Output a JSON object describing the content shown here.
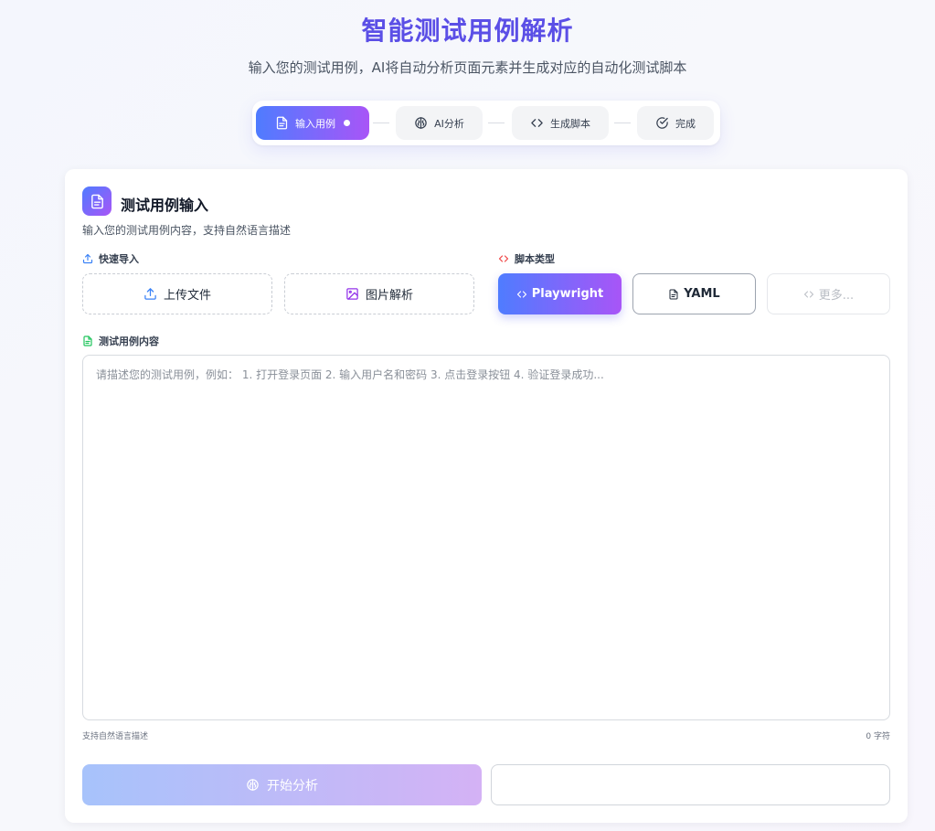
{
  "header": {
    "title": "智能测试用例解析",
    "subtitle": "输入您的测试用例，AI将自动分析页面元素并生成对应的自动化测试脚本"
  },
  "steps": [
    {
      "label": "输入用例",
      "icon": "document-icon",
      "active": true
    },
    {
      "label": "AI分析",
      "icon": "brain-icon",
      "active": false
    },
    {
      "label": "生成脚本",
      "icon": "code-icon",
      "active": false
    },
    {
      "label": "完成",
      "icon": "check-circle-icon",
      "active": false
    }
  ],
  "card": {
    "title": "测试用例输入",
    "description": "输入您的测试用例内容，支持自然语言描述",
    "icon": "document-icon"
  },
  "quick_import": {
    "label": "快速导入",
    "icon": "upload-icon",
    "upload_label": "上传文件",
    "image_label": "图片解析"
  },
  "script_type": {
    "label": "脚本类型",
    "icon": "code-icon",
    "options": [
      {
        "label": "Playwright",
        "selected": true
      },
      {
        "label": "YAML",
        "selected": false
      },
      {
        "label": "更多...",
        "disabled": true
      }
    ]
  },
  "content": {
    "label": "测试用例内容",
    "icon": "file-text-icon",
    "value": "",
    "placeholder": "请描述您的测试用例，例如： 1. 打开登录页面 2. 输入用户名和密码 3. 点击登录按钮 4. 验证登录成功...",
    "hint": "支持自然语言描述",
    "char_count": "0 字符"
  },
  "actions": {
    "start_label": "开始分析"
  },
  "colors": {
    "accent_start": "#4f7cff",
    "accent_end": "#a855f7",
    "title": "#5b4fe6"
  }
}
